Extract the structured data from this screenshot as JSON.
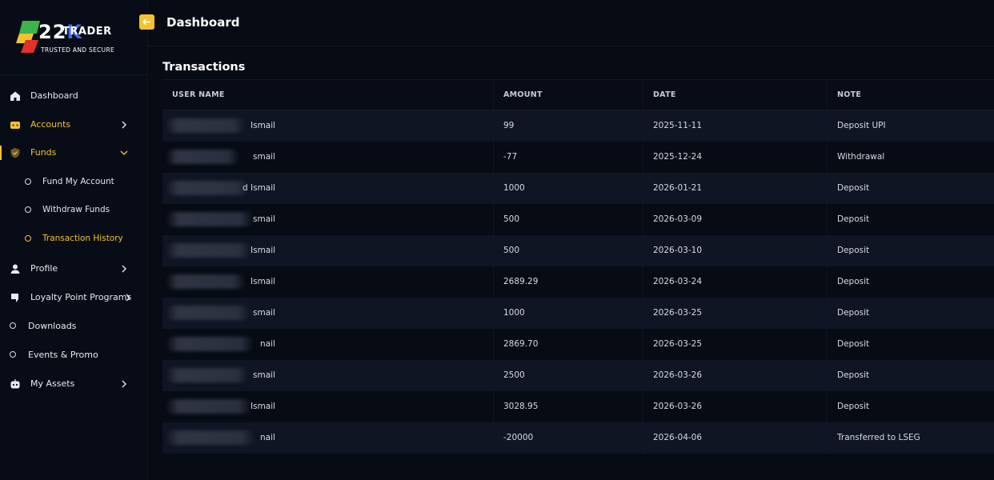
{
  "brand": {
    "logo_main": "22",
    "logo_k": "K",
    "logo_trader": "TRADER",
    "logo_tagline": "TRUSTED AND SECURE",
    "accent_color": "#f2c230"
  },
  "header": {
    "title": "Dashboard",
    "back_icon": "arrow-left-icon"
  },
  "sidebar": {
    "items": [
      {
        "label": "Dashboard",
        "icon": "home-icon"
      },
      {
        "label": "Accounts",
        "icon": "wallet-icon"
      },
      {
        "label": "Funds",
        "icon": "shield-icon"
      },
      {
        "label": "Fund My Account"
      },
      {
        "label": "Withdraw Funds"
      },
      {
        "label": "Transaction History"
      },
      {
        "label": "Profile",
        "icon": "user-icon"
      },
      {
        "label": "Loyalty Point Programs",
        "icon": "bookmark-icon"
      },
      {
        "label": "Downloads"
      },
      {
        "label": "Events & Promo"
      },
      {
        "label": "My Assets",
        "icon": "robot-icon"
      }
    ]
  },
  "main": {
    "section_title": "Transactions",
    "columns": [
      "USER NAME",
      "AMOUNT",
      "DATE",
      "NOTE"
    ],
    "rows": [
      {
        "user": "Ismail",
        "amount": "99",
        "date": "2025-11-11",
        "note": "Deposit UPI"
      },
      {
        "user": "smail",
        "amount": "-77",
        "date": "2025-12-24",
        "note": "Withdrawal"
      },
      {
        "user": "d Ismail",
        "amount": "1000",
        "date": "2026-01-21",
        "note": "Deposit"
      },
      {
        "user": "smail",
        "amount": "500",
        "date": "2026-03-09",
        "note": "Deposit"
      },
      {
        "user": "Ismail",
        "amount": "500",
        "date": "2026-03-10",
        "note": "Deposit"
      },
      {
        "user": "Ismail",
        "amount": "2689.29",
        "date": "2026-03-24",
        "note": "Deposit"
      },
      {
        "user": "smail",
        "amount": "1000",
        "date": "2026-03-25",
        "note": "Deposit"
      },
      {
        "user": "nail",
        "amount": "2869.70",
        "date": "2026-03-25",
        "note": "Deposit"
      },
      {
        "user": "smail",
        "amount": "2500",
        "date": "2026-03-26",
        "note": "Deposit"
      },
      {
        "user": "Ismail",
        "amount": "3028.95",
        "date": "2026-03-26",
        "note": "Deposit"
      },
      {
        "user": "nail",
        "amount": "-20000",
        "date": "2026-04-06",
        "note": "Transferred to LSEG"
      }
    ]
  }
}
